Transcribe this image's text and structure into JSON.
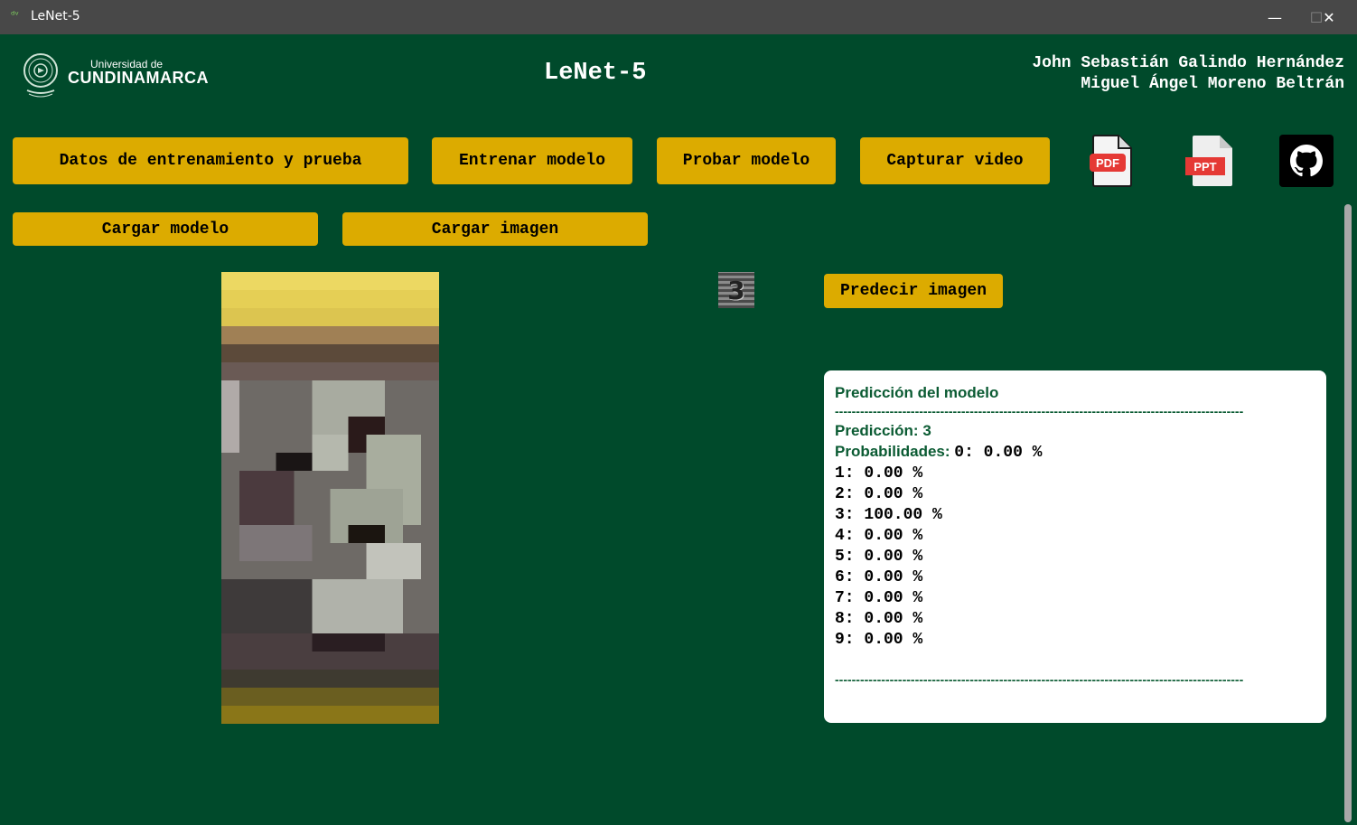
{
  "window": {
    "title": "LeNet-5",
    "controls": {
      "minimize": "—",
      "maximize": "☐",
      "close": "✕"
    }
  },
  "header": {
    "logo_small": "Universidad de",
    "logo_big": "CUNDINAMARCA",
    "title": "LeNet-5",
    "authors": [
      "John Sebastián Galindo Hernández",
      "Miguel Ángel Moreno Beltrán"
    ]
  },
  "toolbar": {
    "datos_label": "Datos de entrenamiento y prueba",
    "entrenar_label": "Entrenar modelo",
    "probar_label": "Probar modelo",
    "capturar_label": "Capturar video",
    "pdf_icon_text": "PDF",
    "ppt_icon_text": "PPT"
  },
  "actions": {
    "cargar_modelo_label": "Cargar modelo",
    "cargar_imagen_label": "Cargar imagen",
    "predecir_label": "Predecir imagen"
  },
  "thumbnail": {
    "digit": "3"
  },
  "result": {
    "title": "Predicción del modelo",
    "separator": "-----------------------------------------------------------------------------------------------------------",
    "prediction_label": "Predicción:",
    "prediction_value": "3",
    "probabilities_label": "Probabilidades:",
    "probabilities": [
      "0: 0.00 %",
      "1: 0.00 %",
      "2: 0.00 %",
      "3: 100.00 %",
      "4: 0.00 %",
      "5: 0.00 %",
      "6: 0.00 %",
      "7: 0.00 %",
      "8: 0.00 %",
      "9: 0.00 %"
    ]
  }
}
